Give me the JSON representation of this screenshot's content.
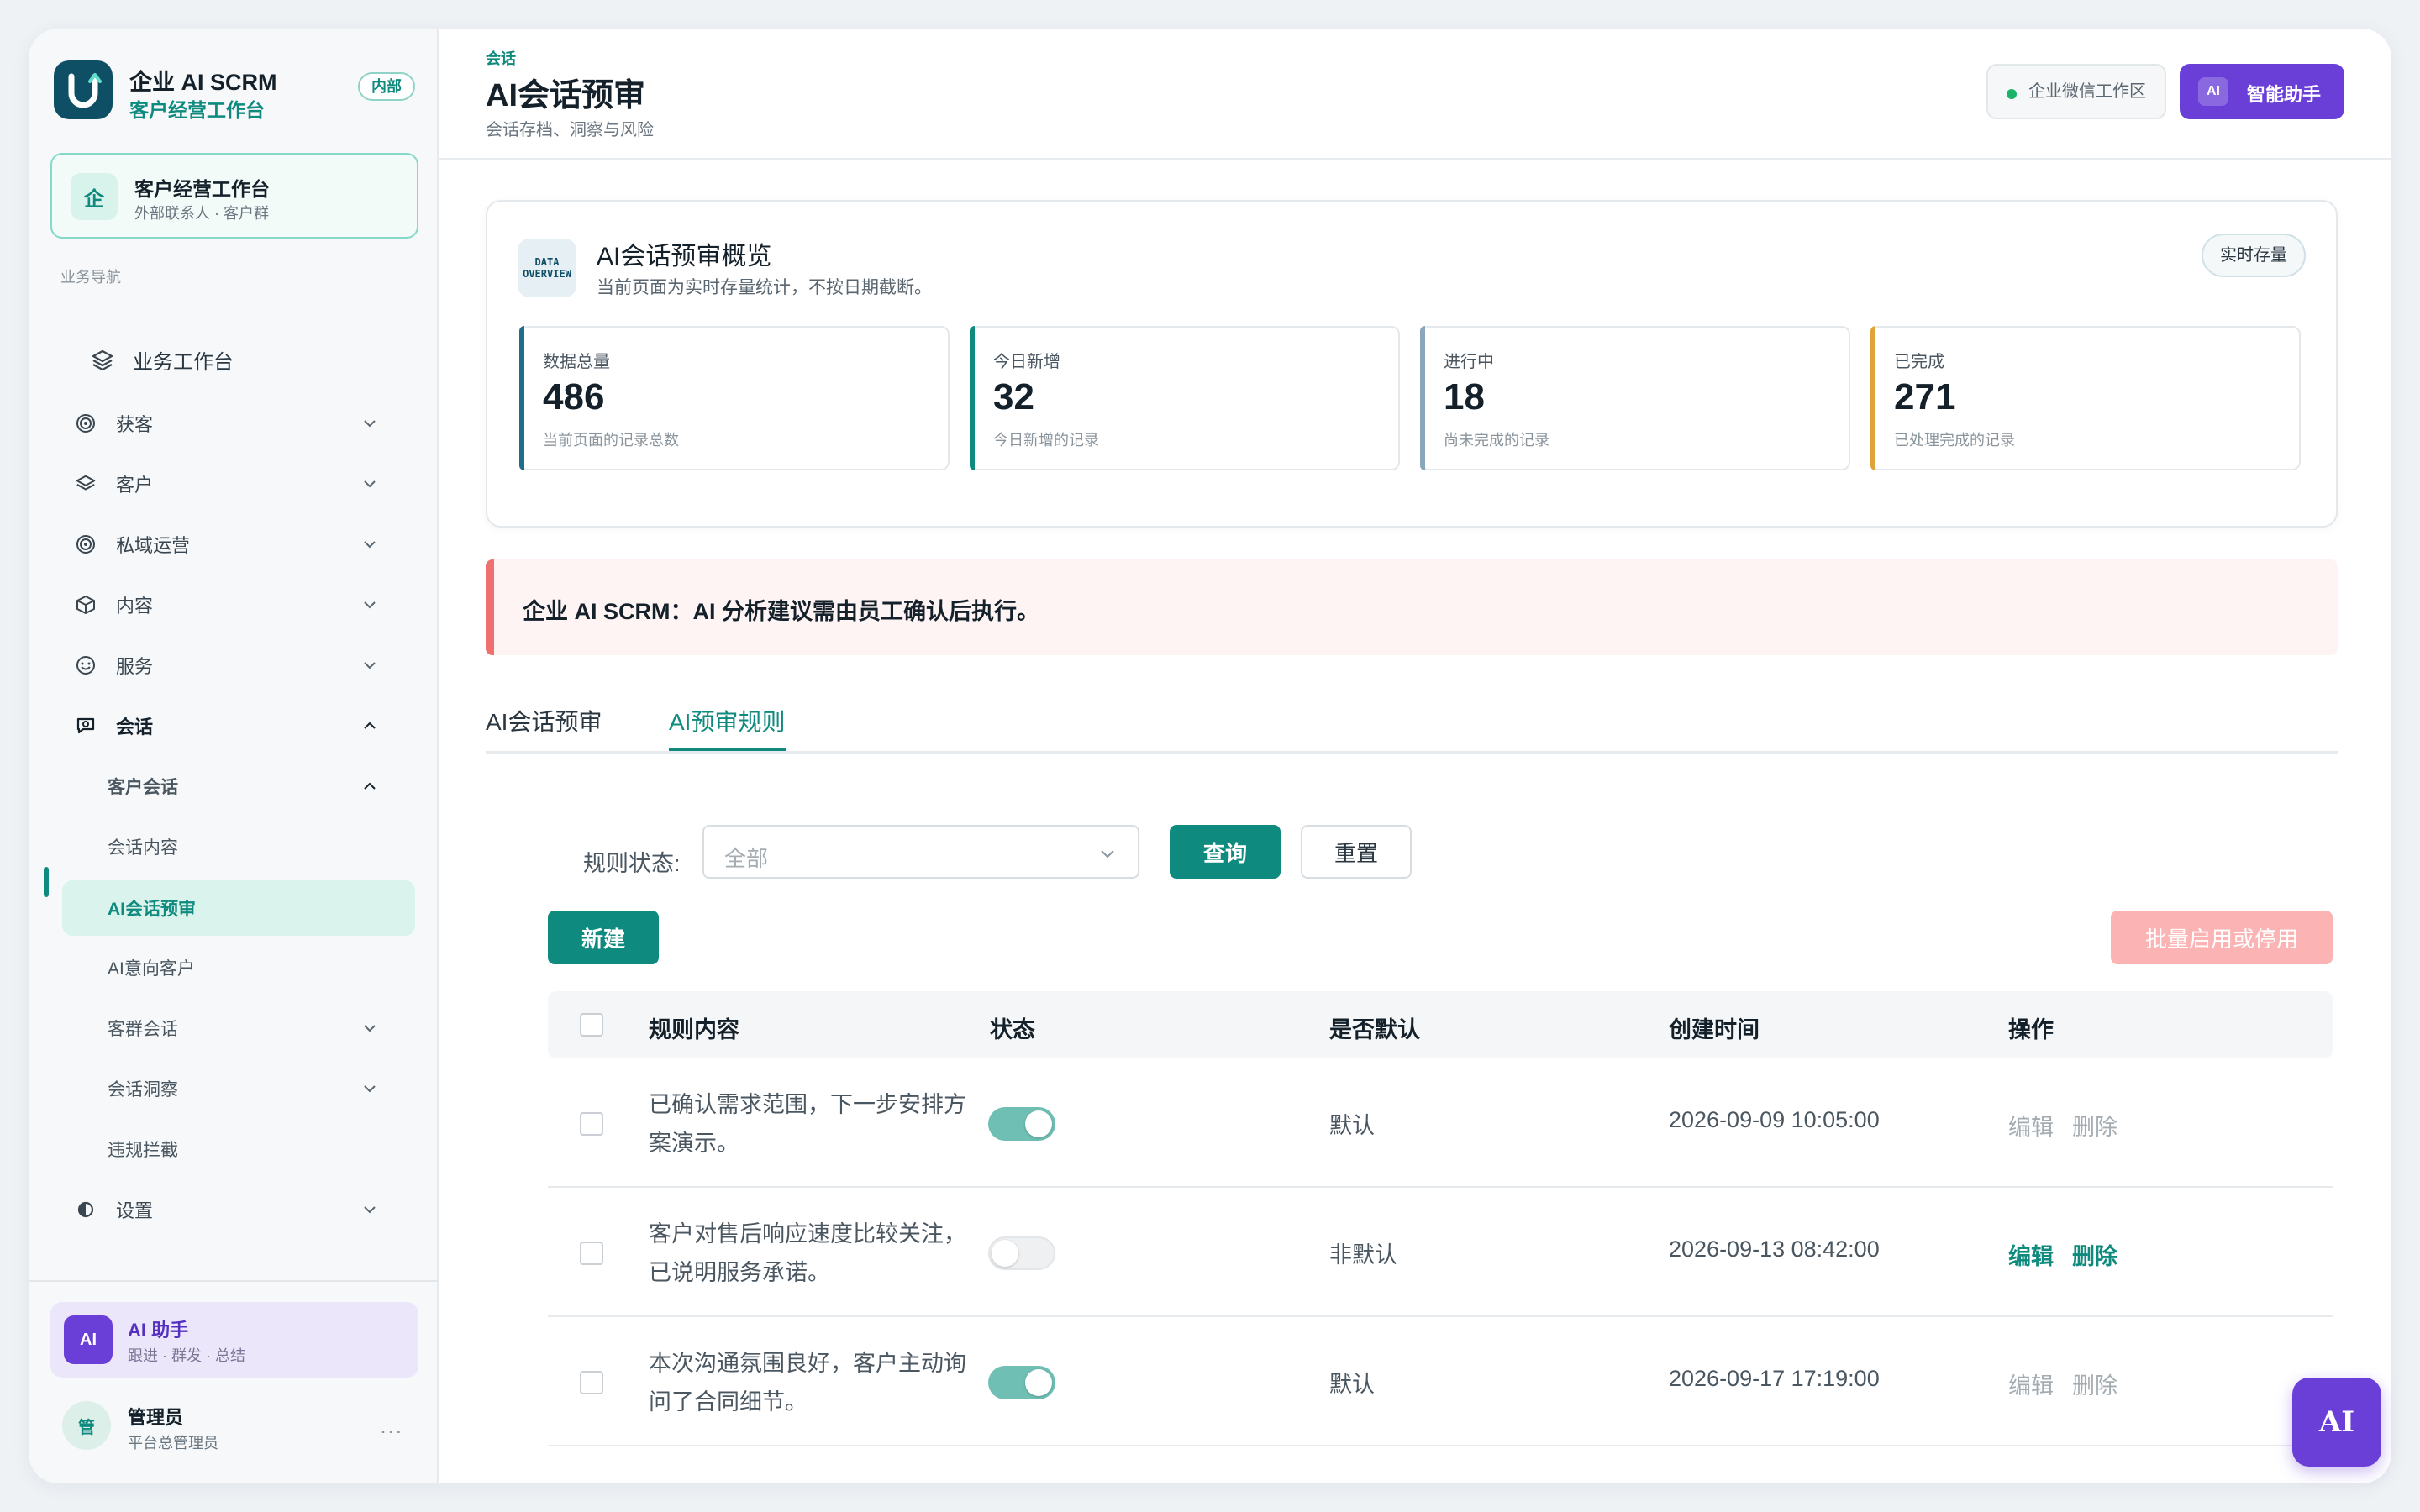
{
  "brand": {
    "title": "企业 AI SCRM",
    "subtitle": "客户经营工作台",
    "badge": "内部"
  },
  "workspace_card": {
    "icon_text": "企",
    "title": "客户经营工作台",
    "subtitle": "外部联系人 · 客户群"
  },
  "sidebar": {
    "section_label": "业务导航",
    "top_item": "业务工作台",
    "items": [
      {
        "label": "获客",
        "icon": "target-icon"
      },
      {
        "label": "客户",
        "icon": "layers-icon"
      },
      {
        "label": "私域运营",
        "icon": "target-icon"
      },
      {
        "label": "内容",
        "icon": "cube-icon"
      },
      {
        "label": "服务",
        "icon": "smile-icon"
      },
      {
        "label": "会话",
        "icon": "chat-search-icon"
      }
    ],
    "group_label": "客户会话",
    "sub_items": [
      {
        "label": "会话内容"
      },
      {
        "label": "AI会话预审"
      },
      {
        "label": "AI意向客户"
      },
      {
        "label": "客群会话"
      },
      {
        "label": "会话洞察"
      },
      {
        "label": "违规拦截"
      }
    ],
    "settings_label": "设置",
    "ai_card": {
      "avatar": "AI",
      "title": "AI 助手",
      "subtitle": "跟进 · 群发 · 总结"
    },
    "user": {
      "avatar": "管",
      "name": "管理员",
      "role": "平台总管理员",
      "more": "..."
    }
  },
  "header": {
    "kicker": "会话",
    "title": "AI会话预审",
    "subtitle": "会话存档、洞察与风险",
    "workspace_label": "企业微信工作区",
    "ai_chip": "AI",
    "ai_button": "智能助手"
  },
  "overview": {
    "badge_line1": "DATA",
    "badge_line2": "OVERVIEW",
    "title": "AI会话预审概览",
    "subtitle": "当前页面为实时存量统计，不按日期截断。",
    "tag": "实时存量",
    "stats": [
      {
        "label": "数据总量",
        "value": "486",
        "desc": "当前页面的记录总数",
        "color": "#1f6f8b"
      },
      {
        "label": "今日新增",
        "value": "32",
        "desc": "今日新增的记录",
        "color": "#0f8a7e"
      },
      {
        "label": "进行中",
        "value": "18",
        "desc": "尚未完成的记录",
        "color": "#8aa6bb"
      },
      {
        "label": "已完成",
        "value": "271",
        "desc": "已处理完成的记录",
        "color": "#e0a23a"
      }
    ]
  },
  "notice": "企业 AI SCRM：AI 分析建议需由员工确认后执行。",
  "tabs": [
    {
      "label": "AI会话预审"
    },
    {
      "label": "AI预审规则"
    }
  ],
  "filter": {
    "label": "规则状态:",
    "value": "全部",
    "query_button": "查询",
    "reset_button": "重置"
  },
  "actions": {
    "new_button": "新建",
    "batch_button": "批量启用或停用"
  },
  "table": {
    "columns": [
      "规则内容",
      "状态",
      "是否默认",
      "创建时间",
      "操作"
    ],
    "rows": [
      {
        "content": "已确认需求范围，下一步安排方案演示。",
        "enabled": true,
        "default": "默认",
        "created": "2026-09-09 10:05:00",
        "edit": "编辑",
        "delete": "删除",
        "actions_active": false
      },
      {
        "content": "客户对售后响应速度比较关注，已说明服务承诺。",
        "enabled": false,
        "default": "非默认",
        "created": "2026-09-13 08:42:00",
        "edit": "编辑",
        "delete": "删除",
        "actions_active": true
      },
      {
        "content": "本次沟通氛围良好，客户主动询问了合同细节。",
        "enabled": true,
        "default": "默认",
        "created": "2026-09-17 17:19:00",
        "edit": "编辑",
        "delete": "删除",
        "actions_active": false
      }
    ]
  },
  "fab_label": "AI"
}
